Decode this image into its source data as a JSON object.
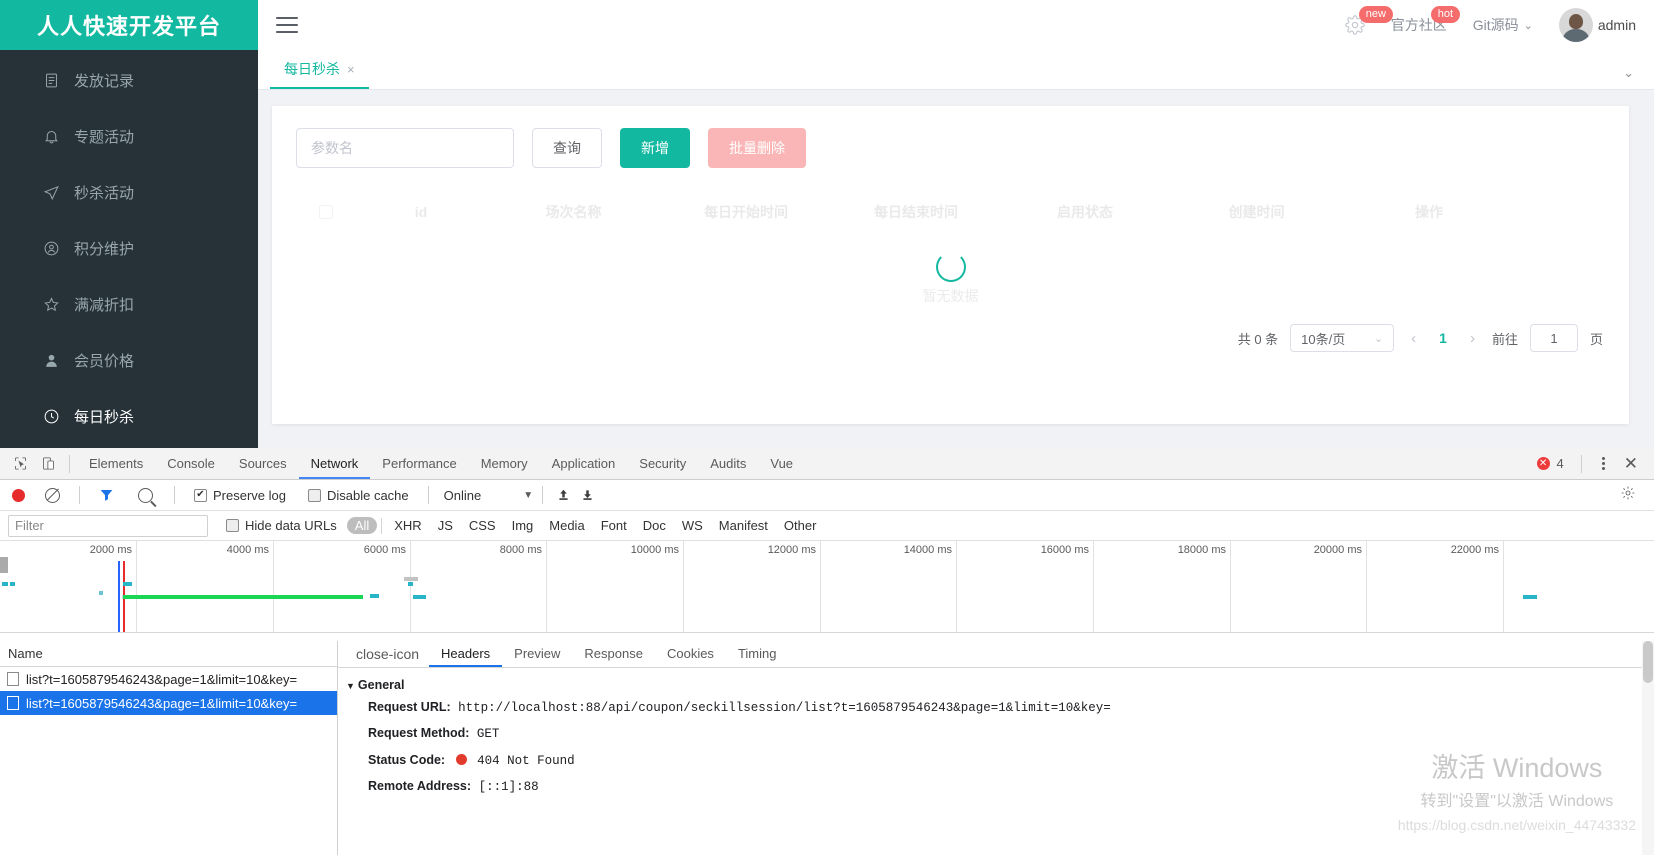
{
  "app": {
    "logo_title": "人人快速开发平台"
  },
  "sidebar": {
    "items": [
      {
        "label": "发放记录",
        "icon": "sql-file-icon",
        "active": false
      },
      {
        "label": "专题活动",
        "icon": "bell-icon",
        "active": false
      },
      {
        "label": "秒杀活动",
        "icon": "send-icon",
        "active": false
      },
      {
        "label": "积分维护",
        "icon": "user-circle-icon",
        "active": false
      },
      {
        "label": "满减折扣",
        "icon": "star-icon",
        "active": false
      },
      {
        "label": "会员价格",
        "icon": "user-filled-icon",
        "active": false
      },
      {
        "label": "每日秒杀",
        "icon": "clock-icon",
        "active": true
      }
    ]
  },
  "topbar": {
    "menu_toggle": "hamburger-icon",
    "settings_badge": "new",
    "community_label": "官方社区",
    "community_badge": "hot",
    "git_label": "Git源码",
    "user_name": "admin"
  },
  "content_tabs": {
    "tabs": [
      {
        "label": "每日秒杀",
        "close": "×",
        "active": true
      }
    ],
    "collapse_icon": "⌄"
  },
  "toolbar": {
    "search_placeholder": "参数名",
    "search_value": "",
    "query_label": "查询",
    "add_label": "新增",
    "batch_delete_label": "批量删除"
  },
  "table": {
    "columns": [
      "",
      "id",
      "场次名称",
      "每日开始时间",
      "每日结束时间",
      "启用状态",
      "创建时间",
      "操作"
    ],
    "empty_text": "暂无数据",
    "rows": []
  },
  "pagination": {
    "total_text": "共 0 条",
    "page_size": "10条/页",
    "prev": "‹",
    "current_page": "1",
    "next": "›",
    "jump_label": "前往",
    "jump_value": "1",
    "page_unit": "页"
  },
  "devtools": {
    "tabs": [
      "Elements",
      "Console",
      "Sources",
      "Network",
      "Performance",
      "Memory",
      "Application",
      "Security",
      "Audits",
      "Vue"
    ],
    "active_tab": "Network",
    "inspect_icon": "inspect-cursor-icon",
    "device_icon": "device-toolbar-icon",
    "error_count": "4",
    "more_icon": "kebab-menu-icon",
    "close_icon": "close-icon",
    "network_toolbar": {
      "record_icon": "record-button",
      "clear_icon": "clear-icon",
      "filter_icon": "funnel-icon",
      "search_icon": "search-icon",
      "preserve_log_label": "Preserve log",
      "preserve_log_checked": true,
      "disable_cache_label": "Disable cache",
      "disable_cache_checked": false,
      "throttling": "Online",
      "import_icon": "upload-icon",
      "export_icon": "download-icon",
      "settings_icon": "gear-icon"
    },
    "filter_bar": {
      "filter_placeholder": "Filter",
      "filter_value": "",
      "hide_data_urls_label": "Hide data URLs",
      "hide_data_urls_checked": false,
      "types": [
        "All",
        "XHR",
        "JS",
        "CSS",
        "Img",
        "Media",
        "Font",
        "Doc",
        "WS",
        "Manifest",
        "Other"
      ],
      "selected_type": "All"
    },
    "overview_ticks": [
      "2000 ms",
      "4000 ms",
      "6000 ms",
      "8000 ms",
      "10000 ms",
      "12000 ms",
      "14000 ms",
      "16000 ms",
      "18000 ms",
      "20000 ms",
      "22000 ms"
    ],
    "request_list": {
      "header": "Name",
      "rows": [
        {
          "name": "list?t=1605879546243&page=1&limit=10&key=",
          "selected": false
        },
        {
          "name": "list?t=1605879546243&page=1&limit=10&key=",
          "selected": true
        }
      ]
    },
    "detail": {
      "tabs": [
        "Headers",
        "Preview",
        "Response",
        "Cookies",
        "Timing"
      ],
      "active_tab": "Headers",
      "close_icon": "close-icon",
      "section_title": "General",
      "fields": [
        {
          "key": "Request URL:",
          "value": "http://localhost:88/api/coupon/seckillsession/list?t=1605879546243&page=1&limit=10&key="
        },
        {
          "key": "Request Method:",
          "value": "GET"
        },
        {
          "key": "Status Code:",
          "value": "404 Not Found",
          "status": true
        },
        {
          "key": "Remote Address:",
          "value": "[::1]:88"
        }
      ]
    }
  },
  "watermark": {
    "line1": "激活 Windows",
    "line2": "转到\"设置\"以激活 Windows",
    "line3": "https://blog.csdn.net/weixin_44743332"
  },
  "colors": {
    "brand": "#13b8a0",
    "sidebar": "#263238",
    "danger": "#fab6b6",
    "devtools_accent": "#1a73e8"
  }
}
